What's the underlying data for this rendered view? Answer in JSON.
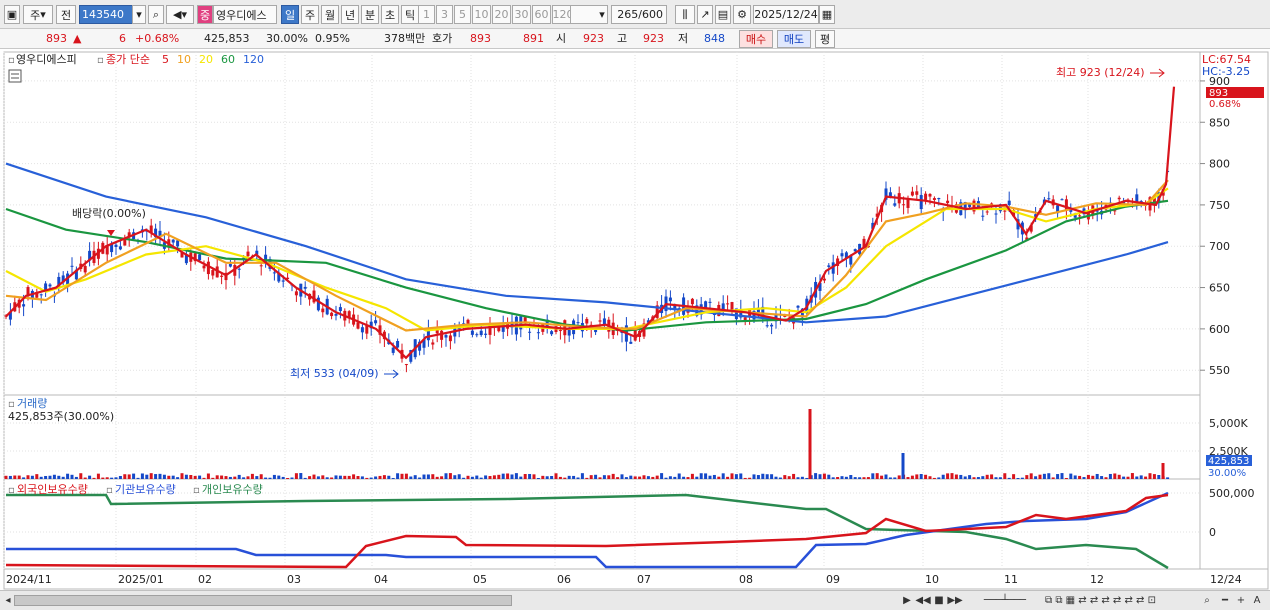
{
  "toolbar": {
    "market_label": "주",
    "prev_label": "전",
    "code": "143540",
    "stock_name": "영우디에스",
    "badge": "중",
    "period_tabs": [
      "일",
      "주",
      "월",
      "년",
      "분",
      "초",
      "틱"
    ],
    "intervals": [
      "1",
      "3",
      "5",
      "10",
      "20",
      "30",
      "60",
      "120"
    ],
    "count": "265",
    "total": "/600",
    "date": "2025/12/24"
  },
  "quote": {
    "price": "893",
    "change_arrow": "▲",
    "change": "6",
    "change_pct": "+0.68%",
    "volume": "425,853",
    "turnover_pct": "30.00%",
    "ratio": "0.95%",
    "amount": "378백만",
    "hoga_label": "호가",
    "ask": "893",
    "bid": "891",
    "open_label": "시",
    "open": "923",
    "high_label": "고",
    "high": "923",
    "low_label": "저",
    "low": "848",
    "buy_label": "매수",
    "sell_label": "매도",
    "avg_label": "평"
  },
  "price_panel": {
    "stock_label": "영우디에스피",
    "ma_label": "종가 단순",
    "ma_periods": [
      "5",
      "10",
      "20",
      "60",
      "120"
    ],
    "ma_colors": [
      "#d8141c",
      "#f0a020",
      "#f5e600",
      "#1a9640",
      "#2860d8"
    ],
    "lc": "LC:67.54",
    "hc": "HC:-3.25",
    "price_tag": "893",
    "pct_tag": "0.68%",
    "high_ann": "최고 923 (12/24)",
    "low_ann": "최저 533 (04/09)",
    "div_ann": "배당락(0.00%)",
    "y_labels": [
      "900",
      "850",
      "800",
      "750",
      "700",
      "650",
      "600",
      "550"
    ]
  },
  "volume_panel": {
    "title": "거래량",
    "value_line": "425,853주(30.00%)",
    "y_labels": [
      "5,000K",
      "2,500K"
    ],
    "tag": "425,853",
    "tag_pct": "30.00%"
  },
  "holding_panel": {
    "legend": [
      "외국인보유수량",
      "기관보유수량",
      "개인보유수량"
    ],
    "colors": [
      "#d8141c",
      "#2850d8",
      "#2a8a50"
    ],
    "y_labels": [
      "500,000",
      "0"
    ]
  },
  "x_axis": {
    "labels": [
      "2024/11",
      "2025/01",
      "02",
      "03",
      "04",
      "05",
      "06",
      "07",
      "08",
      "09",
      "10",
      "11",
      "12",
      "12/24"
    ]
  },
  "chart_data": {
    "type": "candlestick",
    "series": [
      {
        "name": "5",
        "values_by_month": [
          {
            "x": "2024/11",
            "y": 615
          },
          {
            "x": "2025/01",
            "y": 700
          },
          {
            "x": "03",
            "y": 655
          },
          {
            "x": "04",
            "y": 565
          },
          {
            "x": "05",
            "y": 600
          },
          {
            "x": "07",
            "y": 625
          },
          {
            "x": "09",
            "y": 690
          },
          {
            "x": "10",
            "y": 755
          },
          {
            "x": "12",
            "y": 760
          },
          {
            "x": "12/24",
            "y": 815
          }
        ]
      },
      {
        "name": "60",
        "values_by_month": [
          {
            "x": "2024/11",
            "y": 745
          },
          {
            "x": "2025/01",
            "y": 720
          },
          {
            "x": "03",
            "y": 680
          },
          {
            "x": "05",
            "y": 625
          },
          {
            "x": "07",
            "y": 595
          },
          {
            "x": "09",
            "y": 620
          },
          {
            "x": "10",
            "y": 670
          },
          {
            "x": "12",
            "y": 745
          },
          {
            "x": "12/24",
            "y": 755
          }
        ]
      },
      {
        "name": "120",
        "values_by_month": [
          {
            "x": "2024/11",
            "y": 800
          },
          {
            "x": "2025/01",
            "y": 760
          },
          {
            "x": "03",
            "y": 700
          },
          {
            "x": "05",
            "y": 650
          },
          {
            "x": "07",
            "y": 630
          },
          {
            "x": "09",
            "y": 610
          },
          {
            "x": "10",
            "y": 630
          },
          {
            "x": "12",
            "y": 685
          },
          {
            "x": "12/24",
            "y": 705
          }
        ]
      }
    ],
    "high": {
      "value": 923,
      "date": "12/24"
    },
    "low": {
      "value": 533,
      "date": "04/09"
    },
    "ylim": [
      520,
      935
    ]
  }
}
